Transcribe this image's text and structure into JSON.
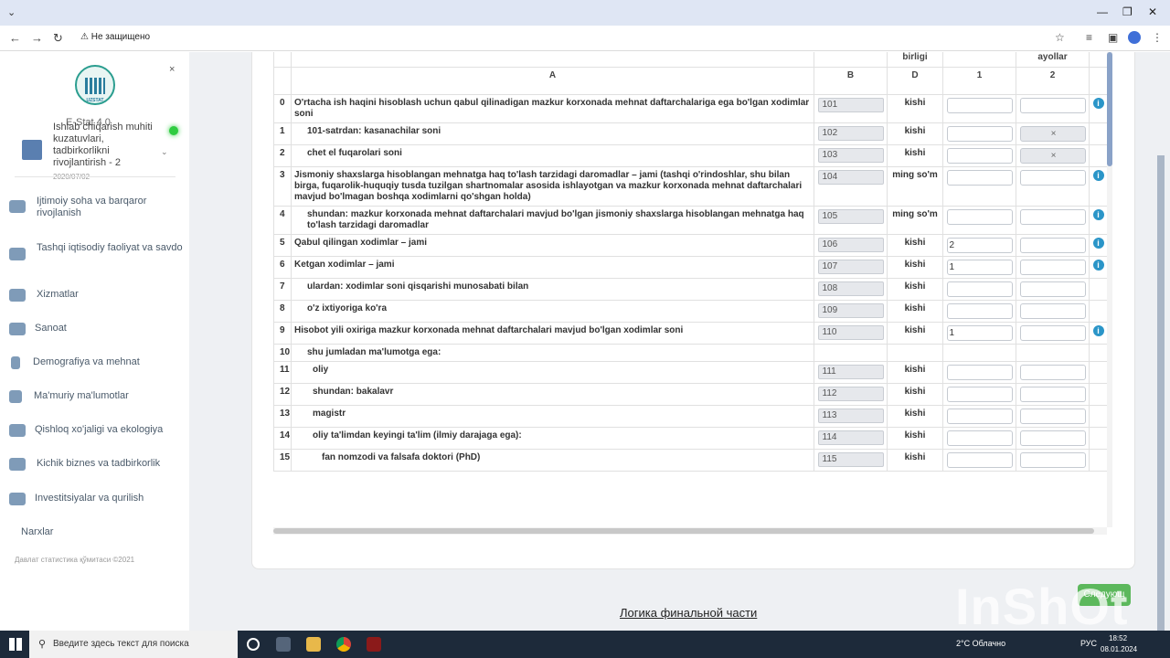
{
  "browser": {
    "security_label": "Не защищено",
    "window_controls": [
      "⌄",
      "—",
      "❐",
      "✕"
    ]
  },
  "sidebar": {
    "app_name": "E-Stat 4.0",
    "form_title": "Ishlab chiqarish muhiti kuzatuvlari, tadbirkorlikni rivojlantirish - 2",
    "form_date": "2020/07/02",
    "close_symbol": "×",
    "logo_text": "UZSTAT",
    "menu": [
      {
        "label": "Ijtimoiy soha va barqaror rivojlanish",
        "icon": "users-icon"
      },
      {
        "label": "Tashqi iqtisodiy faoliyat va savdo",
        "icon": "ship-icon"
      },
      {
        "label": "Xizmatlar",
        "icon": "leaf-icon"
      },
      {
        "label": "Sanoat",
        "icon": "factory-icon"
      },
      {
        "label": "Demografiya va mehnat",
        "icon": "building-icon"
      },
      {
        "label": "Ma'muriy ma'lumotlar",
        "icon": "paint-roller-icon"
      },
      {
        "label": "Qishloq xo'jaligi va ekologiya",
        "icon": "tractor-icon"
      },
      {
        "label": "Kichik biznes va tadbirkorlik",
        "icon": "id-card-icon"
      },
      {
        "label": "Investitsiyalar va qurilish",
        "icon": "tools-icon"
      },
      {
        "label": "Narxlar",
        "icon": ""
      }
    ],
    "copyright": "Давлат статистика қўмитаси ©2021"
  },
  "table": {
    "header_top": {
      "unit": "birligi",
      "women": "ayollar"
    },
    "header": {
      "a": "A",
      "b": "B",
      "d": "D",
      "c1": "1",
      "c2": "2"
    },
    "rows": [
      {
        "num": "0",
        "desc": "O'rtacha ish haqini hisoblash uchun qabul qilinadigan mazkur korxonada mehnat daftarchalariga ega bo'lgan xodimlar soni",
        "indent": 0,
        "code": "101",
        "unit": "kishi",
        "v1": "",
        "v2": "",
        "v2_disabled": false,
        "info": true
      },
      {
        "num": "1",
        "desc": "101-satrdan: kasanachilar soni",
        "indent": 1,
        "code": "102",
        "unit": "kishi",
        "v1": "",
        "v2": "×",
        "v2_disabled": true,
        "info": false
      },
      {
        "num": "2",
        "desc": "chet el fuqarolari soni",
        "indent": 1,
        "code": "103",
        "unit": "kishi",
        "v1": "",
        "v2": "×",
        "v2_disabled": true,
        "info": false
      },
      {
        "num": "3",
        "desc": "Jismoniy shaxslarga hisoblangan mehnatga haq to'lash tarzidagi daromadlar – jami (tashqi o'rindoshlar, shu bilan birga, fuqarolik-huquqiy tusda tuzilgan shartnomalar asosida ishlayotgan va mazkur korxonada mehnat daftarchalari mavjud bo'lmagan boshqa xodimlarni qo'shgan holda)",
        "indent": 0,
        "code": "104",
        "unit": "ming so'm",
        "v1": "",
        "v2": "",
        "v2_disabled": false,
        "info": true
      },
      {
        "num": "4",
        "desc": "shundan: mazkur korxonada mehnat daftarchalari mavjud bo'lgan jismoniy shaxslarga hisoblangan mehnatga haq to'lash tarzidagi daromadlar",
        "indent": 1,
        "code": "105",
        "unit": "ming so'm",
        "v1": "",
        "v2": "",
        "v2_disabled": false,
        "info": true
      },
      {
        "num": "5",
        "desc": "Qabul qilingan xodimlar – jami",
        "indent": 0,
        "code": "106",
        "unit": "kishi",
        "v1": "2",
        "v2": "",
        "v2_disabled": false,
        "info": true
      },
      {
        "num": "6",
        "desc": "Ketgan xodimlar – jami",
        "indent": 0,
        "code": "107",
        "unit": "kishi",
        "v1": "1",
        "v2": "",
        "v2_disabled": false,
        "info": true
      },
      {
        "num": "7",
        "desc": "ulardan: xodimlar soni qisqarishi munosabati bilan",
        "indent": 1,
        "code": "108",
        "unit": "kishi",
        "v1": "",
        "v2": "",
        "v2_disabled": false,
        "info": false
      },
      {
        "num": "8",
        "desc": "o'z ixtiyoriga ko'ra",
        "indent": 1,
        "code": "109",
        "unit": "kishi",
        "v1": "",
        "v2": "",
        "v2_disabled": false,
        "info": false
      },
      {
        "num": "9",
        "desc": "Hisobot yili oxiriga mazkur korxonada mehnat daftarchalari mavjud bo'lgan xodimlar soni",
        "indent": 0,
        "code": "110",
        "unit": "kishi",
        "v1": "1",
        "v2": "",
        "v2_disabled": false,
        "info": true
      },
      {
        "num": "10",
        "desc": "shu jumladan ma'lumotga ega:",
        "indent": 1,
        "code": "",
        "unit": "",
        "v1": null,
        "v2": null,
        "v2_disabled": false,
        "info": false
      },
      {
        "num": "11",
        "desc": "oliy",
        "indent": 2,
        "code": "111",
        "unit": "kishi",
        "v1": "",
        "v2": "",
        "v2_disabled": false,
        "info": false
      },
      {
        "num": "12",
        "desc": "shundan: bakalavr",
        "indent": 2,
        "code": "112",
        "unit": "kishi",
        "v1": "",
        "v2": "",
        "v2_disabled": false,
        "info": false
      },
      {
        "num": "13",
        "desc": "magistr",
        "indent": 2,
        "code": "113",
        "unit": "kishi",
        "v1": "",
        "v2": "",
        "v2_disabled": false,
        "info": false
      },
      {
        "num": "14",
        "desc": "oliy ta'limdan keyingi ta'lim (ilmiy darajaga ega):",
        "indent": 2,
        "code": "114",
        "unit": "kishi",
        "v1": "",
        "v2": "",
        "v2_disabled": false,
        "info": false
      },
      {
        "num": "15",
        "desc": "fan nomzodi va falsafa doktori (PhD)",
        "indent": 3,
        "code": "115",
        "unit": "kishi",
        "v1": "",
        "v2": "",
        "v2_disabled": false,
        "info": false
      }
    ]
  },
  "footer": {
    "link": "Логика финальной части",
    "next_button": "Следующ"
  },
  "watermark": "InShOt",
  "taskbar": {
    "search_placeholder": "Введите здесь текст для поиска",
    "weather": "2°C Облачно",
    "lang": "РУС",
    "time": "18:52",
    "date": "08.01.2024"
  }
}
